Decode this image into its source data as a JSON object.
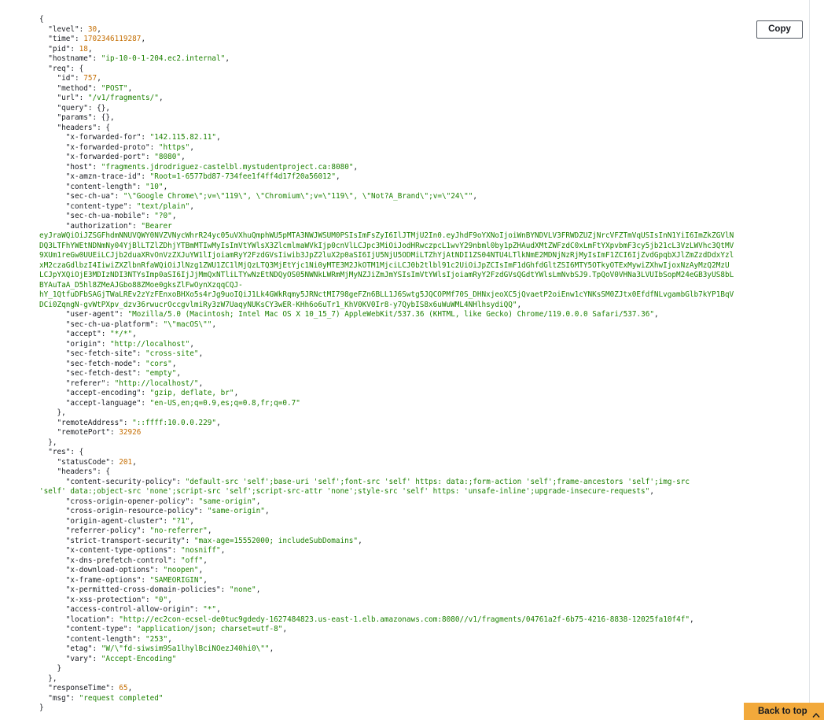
{
  "toolbar": {
    "copy_label": "Copy",
    "back_to_top_label": "Back to top"
  },
  "icons": {
    "back_to_top": "chevron-up-icon"
  },
  "colors": {
    "key": "#16191f",
    "string": "#1d8102",
    "number": "#c46d00",
    "accent": "#f2a93b"
  },
  "log_lines": [
    [
      [
        "p",
        "{"
      ]
    ],
    [
      [
        "p",
        "  "
      ],
      [
        "k",
        "\"level\""
      ],
      [
        "p",
        ": "
      ],
      [
        "n",
        "30"
      ],
      [
        "p",
        ","
      ]
    ],
    [
      [
        "p",
        "  "
      ],
      [
        "k",
        "\"time\""
      ],
      [
        "p",
        ": "
      ],
      [
        "n",
        "1702346119287"
      ],
      [
        "p",
        ","
      ]
    ],
    [
      [
        "p",
        "  "
      ],
      [
        "k",
        "\"pid\""
      ],
      [
        "p",
        ": "
      ],
      [
        "n",
        "18"
      ],
      [
        "p",
        ","
      ]
    ],
    [
      [
        "p",
        "  "
      ],
      [
        "k",
        "\"hostname\""
      ],
      [
        "p",
        ": "
      ],
      [
        "s",
        "\"ip-10-0-1-204.ec2.internal\""
      ],
      [
        "p",
        ","
      ]
    ],
    [
      [
        "p",
        "  "
      ],
      [
        "k",
        "\"req\""
      ],
      [
        "p",
        ": {"
      ]
    ],
    [
      [
        "p",
        "    "
      ],
      [
        "k",
        "\"id\""
      ],
      [
        "p",
        ": "
      ],
      [
        "n",
        "757"
      ],
      [
        "p",
        ","
      ]
    ],
    [
      [
        "p",
        "    "
      ],
      [
        "k",
        "\"method\""
      ],
      [
        "p",
        ": "
      ],
      [
        "s",
        "\"POST\""
      ],
      [
        "p",
        ","
      ]
    ],
    [
      [
        "p",
        "    "
      ],
      [
        "k",
        "\"url\""
      ],
      [
        "p",
        ": "
      ],
      [
        "s",
        "\"/v1/fragments/\""
      ],
      [
        "p",
        ","
      ]
    ],
    [
      [
        "p",
        "    "
      ],
      [
        "k",
        "\"query\""
      ],
      [
        "p",
        ": {},"
      ]
    ],
    [
      [
        "p",
        "    "
      ],
      [
        "k",
        "\"params\""
      ],
      [
        "p",
        ": {},"
      ]
    ],
    [
      [
        "p",
        "    "
      ],
      [
        "k",
        "\"headers\""
      ],
      [
        "p",
        ": {"
      ]
    ],
    [
      [
        "p",
        "      "
      ],
      [
        "k",
        "\"x-forwarded-for\""
      ],
      [
        "p",
        ": "
      ],
      [
        "s",
        "\"142.115.82.11\""
      ],
      [
        "p",
        ","
      ]
    ],
    [
      [
        "p",
        "      "
      ],
      [
        "k",
        "\"x-forwarded-proto\""
      ],
      [
        "p",
        ": "
      ],
      [
        "s",
        "\"https\""
      ],
      [
        "p",
        ","
      ]
    ],
    [
      [
        "p",
        "      "
      ],
      [
        "k",
        "\"x-forwarded-port\""
      ],
      [
        "p",
        ": "
      ],
      [
        "s",
        "\"8080\""
      ],
      [
        "p",
        ","
      ]
    ],
    [
      [
        "p",
        "      "
      ],
      [
        "k",
        "\"host\""
      ],
      [
        "p",
        ": "
      ],
      [
        "s",
        "\"fragments.jdrodriguez-castelbl.mystudentproject.ca:8080\""
      ],
      [
        "p",
        ","
      ]
    ],
    [
      [
        "p",
        "      "
      ],
      [
        "k",
        "\"x-amzn-trace-id\""
      ],
      [
        "p",
        ": "
      ],
      [
        "s",
        "\"Root=1-6577bd87-734fee1f4ff4d17f20a56012\""
      ],
      [
        "p",
        ","
      ]
    ],
    [
      [
        "p",
        "      "
      ],
      [
        "k",
        "\"content-length\""
      ],
      [
        "p",
        ": "
      ],
      [
        "s",
        "\"10\""
      ],
      [
        "p",
        ","
      ]
    ],
    [
      [
        "p",
        "      "
      ],
      [
        "k",
        "\"sec-ch-ua\""
      ],
      [
        "p",
        ": "
      ],
      [
        "s",
        "\"\\\"Google Chrome\\\";v=\\\"119\\\", \\\"Chromium\\\";v=\\\"119\\\", \\\"Not?A_Brand\\\";v=\\\"24\\\"\""
      ],
      [
        "p",
        ","
      ]
    ],
    [
      [
        "p",
        "      "
      ],
      [
        "k",
        "\"content-type\""
      ],
      [
        "p",
        ": "
      ],
      [
        "s",
        "\"text/plain\""
      ],
      [
        "p",
        ","
      ]
    ],
    [
      [
        "p",
        "      "
      ],
      [
        "k",
        "\"sec-ch-ua-mobile\""
      ],
      [
        "p",
        ": "
      ],
      [
        "s",
        "\"?0\""
      ],
      [
        "p",
        ","
      ]
    ],
    [
      [
        "p",
        "      "
      ],
      [
        "k",
        "\"authorization\""
      ],
      [
        "p",
        ": "
      ],
      [
        "s",
        "\"Bearer"
      ]
    ],
    [
      [
        "s",
        "eyJraWQiOiJZSGFhdmNNUVQWY0NVZVNycWhrR24yc05uVXhuQmphWU5pMTA3NWJWSUM0PSIsImFsZyI6IlJTMjU2In0.eyJhdF9oYXNoIjoiWnBYNDVLV3FRWDZUZjNrcVFZTmVqUSIsInN1YiI6ImZkZGVlN"
      ]
    ],
    [
      [
        "s",
        "DQ3LTFhYWEtNDNmNy04YjBlLTZlZDhjYTBmMTIwMyIsImVtYWlsX3ZlcmlmaWVkIjp0cnVlLCJpc3MiOiJodHRwczpcL1wvY29nbml0by1pZHAudXMtZWFzdC0xLmFtYXpvbmF3cy5jb21cL3VzLWVhc3QtMV"
      ]
    ],
    [
      [
        "s",
        "9XUm1reGw0UUEiLCJjb2duaXRvOnVzZXJuYW1lIjoiamRyY2FzdGVsIiwib3JpZ2luX2p0aSI6IjU5NjU5ODMiLTZhYjAtNDI1ZS04NTU4LTlkNmE2MDNjNzRjMyIsImF1ZCI6IjZvdGpqbXJlZmZzdDdxYzl"
      ]
    ],
    [
      [
        "s",
        "xM2czaGdlbzI4IiwiZXZlbnRfaWQiOiJlNzg1ZWU1ZC1lMjQzLTQ3MjEtYjc1Ni0yMTE3M2JkOTM1MjciLCJ0b2tlbl91c2UiOiJpZCIsImF1dGhfdGltZSI6MTY5OTkyOTExMywiZXhwIjoxNzAyMzQ2MzU"
      ]
    ],
    [
      [
        "s",
        "LCJpYXQiOjE3MDIzNDI3NTYsImp0aSI6IjJjMmQxNTliLTYwNzEtNDQyOS05NWNkLWRmMjMyNZJiZmJmYSIsImVtYWlsIjoiamRyY2FzdGVsQGdtYWlsLmNvbSJ9.TpQoV0VHNa3LVUIbSopM24eGB3yUS8bL"
      ]
    ],
    [
      [
        "s",
        "BYAuTaA_D5hl8ZMeAJGbo88ZMoe0gksZlFwOynXzqqCQJ-"
      ]
    ],
    [
      [
        "s",
        "hY_1QtfuDFbSAGjTWaLREv2zYzFEnxoBHXo5s4rJg9uoIQiJ1Lk4GWkRqmy5JRNctMI798geFZn6BLL1J6Swtg5JQCOPMf70S_DHNxjeoXC5jQvaetP2oiEnw1cYNKsSM0ZJtx0EfdfNLvgambGlb7kYP1BqV"
      ]
    ],
    [
      [
        "s",
        "DCi0ZqngN-gvWtPXpv_dzv36rwucrOccgvlmiRy3zW7UaqyNUKsCY3wER-KHh6o6uTr1_KhV0KV0Ir8-y7QybIS8x6uWuWML4NHlhsydiQQ\""
      ],
      [
        "p",
        ","
      ]
    ],
    [
      [
        "p",
        "      "
      ],
      [
        "k",
        "\"user-agent\""
      ],
      [
        "p",
        ": "
      ],
      [
        "s",
        "\"Mozilla/5.0 (Macintosh; Intel Mac OS X 10_15_7) AppleWebKit/537.36 (KHTML, like Gecko) Chrome/119.0.0.0 Safari/537.36\""
      ],
      [
        "p",
        ","
      ]
    ],
    [
      [
        "p",
        "      "
      ],
      [
        "k",
        "\"sec-ch-ua-platform\""
      ],
      [
        "p",
        ": "
      ],
      [
        "s",
        "\"\\\"macOS\\\"\""
      ],
      [
        "p",
        ","
      ]
    ],
    [
      [
        "p",
        "      "
      ],
      [
        "k",
        "\"accept\""
      ],
      [
        "p",
        ": "
      ],
      [
        "s",
        "\"*/*\""
      ],
      [
        "p",
        ","
      ]
    ],
    [
      [
        "p",
        "      "
      ],
      [
        "k",
        "\"origin\""
      ],
      [
        "p",
        ": "
      ],
      [
        "s",
        "\"http://localhost\""
      ],
      [
        "p",
        ","
      ]
    ],
    [
      [
        "p",
        "      "
      ],
      [
        "k",
        "\"sec-fetch-site\""
      ],
      [
        "p",
        ": "
      ],
      [
        "s",
        "\"cross-site\""
      ],
      [
        "p",
        ","
      ]
    ],
    [
      [
        "p",
        "      "
      ],
      [
        "k",
        "\"sec-fetch-mode\""
      ],
      [
        "p",
        ": "
      ],
      [
        "s",
        "\"cors\""
      ],
      [
        "p",
        ","
      ]
    ],
    [
      [
        "p",
        "      "
      ],
      [
        "k",
        "\"sec-fetch-dest\""
      ],
      [
        "p",
        ": "
      ],
      [
        "s",
        "\"empty\""
      ],
      [
        "p",
        ","
      ]
    ],
    [
      [
        "p",
        "      "
      ],
      [
        "k",
        "\"referer\""
      ],
      [
        "p",
        ": "
      ],
      [
        "s",
        "\"http://localhost/\""
      ],
      [
        "p",
        ","
      ]
    ],
    [
      [
        "p",
        "      "
      ],
      [
        "k",
        "\"accept-encoding\""
      ],
      [
        "p",
        ": "
      ],
      [
        "s",
        "\"gzip, deflate, br\""
      ],
      [
        "p",
        ","
      ]
    ],
    [
      [
        "p",
        "      "
      ],
      [
        "k",
        "\"accept-language\""
      ],
      [
        "p",
        ": "
      ],
      [
        "s",
        "\"en-US,en;q=0.9,es;q=0.8,fr;q=0.7\""
      ]
    ],
    [
      [
        "p",
        "    },"
      ]
    ],
    [
      [
        "p",
        "    "
      ],
      [
        "k",
        "\"remoteAddress\""
      ],
      [
        "p",
        ": "
      ],
      [
        "s",
        "\"::ffff:10.0.0.229\""
      ],
      [
        "p",
        ","
      ]
    ],
    [
      [
        "p",
        "    "
      ],
      [
        "k",
        "\"remotePort\""
      ],
      [
        "p",
        ": "
      ],
      [
        "n",
        "32926"
      ]
    ],
    [
      [
        "p",
        "  },"
      ]
    ],
    [
      [
        "p",
        "  "
      ],
      [
        "k",
        "\"res\""
      ],
      [
        "p",
        ": {"
      ]
    ],
    [
      [
        "p",
        "    "
      ],
      [
        "k",
        "\"statusCode\""
      ],
      [
        "p",
        ": "
      ],
      [
        "n",
        "201"
      ],
      [
        "p",
        ","
      ]
    ],
    [
      [
        "p",
        "    "
      ],
      [
        "k",
        "\"headers\""
      ],
      [
        "p",
        ": {"
      ]
    ],
    [
      [
        "p",
        "      "
      ],
      [
        "k",
        "\"content-security-policy\""
      ],
      [
        "p",
        ": "
      ],
      [
        "s",
        "\"default-src 'self';base-uri 'self';font-src 'self' https: data:;form-action 'self';frame-ancestors 'self';img-src"
      ]
    ],
    [
      [
        "s",
        "'self' data:;object-src 'none';script-src 'self';script-src-attr 'none';style-src 'self' https: 'unsafe-inline';upgrade-insecure-requests\""
      ],
      [
        "p",
        ","
      ]
    ],
    [
      [
        "p",
        "      "
      ],
      [
        "k",
        "\"cross-origin-opener-policy\""
      ],
      [
        "p",
        ": "
      ],
      [
        "s",
        "\"same-origin\""
      ],
      [
        "p",
        ","
      ]
    ],
    [
      [
        "p",
        "      "
      ],
      [
        "k",
        "\"cross-origin-resource-policy\""
      ],
      [
        "p",
        ": "
      ],
      [
        "s",
        "\"same-origin\""
      ],
      [
        "p",
        ","
      ]
    ],
    [
      [
        "p",
        "      "
      ],
      [
        "k",
        "\"origin-agent-cluster\""
      ],
      [
        "p",
        ": "
      ],
      [
        "s",
        "\"?1\""
      ],
      [
        "p",
        ","
      ]
    ],
    [
      [
        "p",
        "      "
      ],
      [
        "k",
        "\"referrer-policy\""
      ],
      [
        "p",
        ": "
      ],
      [
        "s",
        "\"no-referrer\""
      ],
      [
        "p",
        ","
      ]
    ],
    [
      [
        "p",
        "      "
      ],
      [
        "k",
        "\"strict-transport-security\""
      ],
      [
        "p",
        ": "
      ],
      [
        "s",
        "\"max-age=15552000; includeSubDomains\""
      ],
      [
        "p",
        ","
      ]
    ],
    [
      [
        "p",
        "      "
      ],
      [
        "k",
        "\"x-content-type-options\""
      ],
      [
        "p",
        ": "
      ],
      [
        "s",
        "\"nosniff\""
      ],
      [
        "p",
        ","
      ]
    ],
    [
      [
        "p",
        "      "
      ],
      [
        "k",
        "\"x-dns-prefetch-control\""
      ],
      [
        "p",
        ": "
      ],
      [
        "s",
        "\"off\""
      ],
      [
        "p",
        ","
      ]
    ],
    [
      [
        "p",
        "      "
      ],
      [
        "k",
        "\"x-download-options\""
      ],
      [
        "p",
        ": "
      ],
      [
        "s",
        "\"noopen\""
      ],
      [
        "p",
        ","
      ]
    ],
    [
      [
        "p",
        "      "
      ],
      [
        "k",
        "\"x-frame-options\""
      ],
      [
        "p",
        ": "
      ],
      [
        "s",
        "\"SAMEORIGIN\""
      ],
      [
        "p",
        ","
      ]
    ],
    [
      [
        "p",
        "      "
      ],
      [
        "k",
        "\"x-permitted-cross-domain-policies\""
      ],
      [
        "p",
        ": "
      ],
      [
        "s",
        "\"none\""
      ],
      [
        "p",
        ","
      ]
    ],
    [
      [
        "p",
        "      "
      ],
      [
        "k",
        "\"x-xss-protection\""
      ],
      [
        "p",
        ": "
      ],
      [
        "s",
        "\"0\""
      ],
      [
        "p",
        ","
      ]
    ],
    [
      [
        "p",
        "      "
      ],
      [
        "k",
        "\"access-control-allow-origin\""
      ],
      [
        "p",
        ": "
      ],
      [
        "s",
        "\"*\""
      ],
      [
        "p",
        ","
      ]
    ],
    [
      [
        "p",
        "      "
      ],
      [
        "k",
        "\"location\""
      ],
      [
        "p",
        ": "
      ],
      [
        "s",
        "\"http://ec2con-ecsel-de0tuc9gdedy-1627484823.us-east-1.elb.amazonaws.com:8080//v1/fragments/04761a2f-6b75-4216-8838-12025fa10f4f\""
      ],
      [
        "p",
        ","
      ]
    ],
    [
      [
        "p",
        "      "
      ],
      [
        "k",
        "\"content-type\""
      ],
      [
        "p",
        ": "
      ],
      [
        "s",
        "\"application/json; charset=utf-8\""
      ],
      [
        "p",
        ","
      ]
    ],
    [
      [
        "p",
        "      "
      ],
      [
        "k",
        "\"content-length\""
      ],
      [
        "p",
        ": "
      ],
      [
        "s",
        "\"253\""
      ],
      [
        "p",
        ","
      ]
    ],
    [
      [
        "p",
        "      "
      ],
      [
        "k",
        "\"etag\""
      ],
      [
        "p",
        ": "
      ],
      [
        "s",
        "\"W/\\\"fd-siwsim9Sa1lhylBciNOezJ40hi0\\\"\""
      ],
      [
        "p",
        ","
      ]
    ],
    [
      [
        "p",
        "      "
      ],
      [
        "k",
        "\"vary\""
      ],
      [
        "p",
        ": "
      ],
      [
        "s",
        "\"Accept-Encoding\""
      ]
    ],
    [
      [
        "p",
        "    }"
      ]
    ],
    [
      [
        "p",
        "  },"
      ]
    ],
    [
      [
        "p",
        "  "
      ],
      [
        "k",
        "\"responseTime\""
      ],
      [
        "p",
        ": "
      ],
      [
        "n",
        "65"
      ],
      [
        "p",
        ","
      ]
    ],
    [
      [
        "p",
        "  "
      ],
      [
        "k",
        "\"msg\""
      ],
      [
        "p",
        ": "
      ],
      [
        "s",
        "\"request completed\""
      ]
    ],
    [
      [
        "p",
        "}"
      ]
    ]
  ]
}
